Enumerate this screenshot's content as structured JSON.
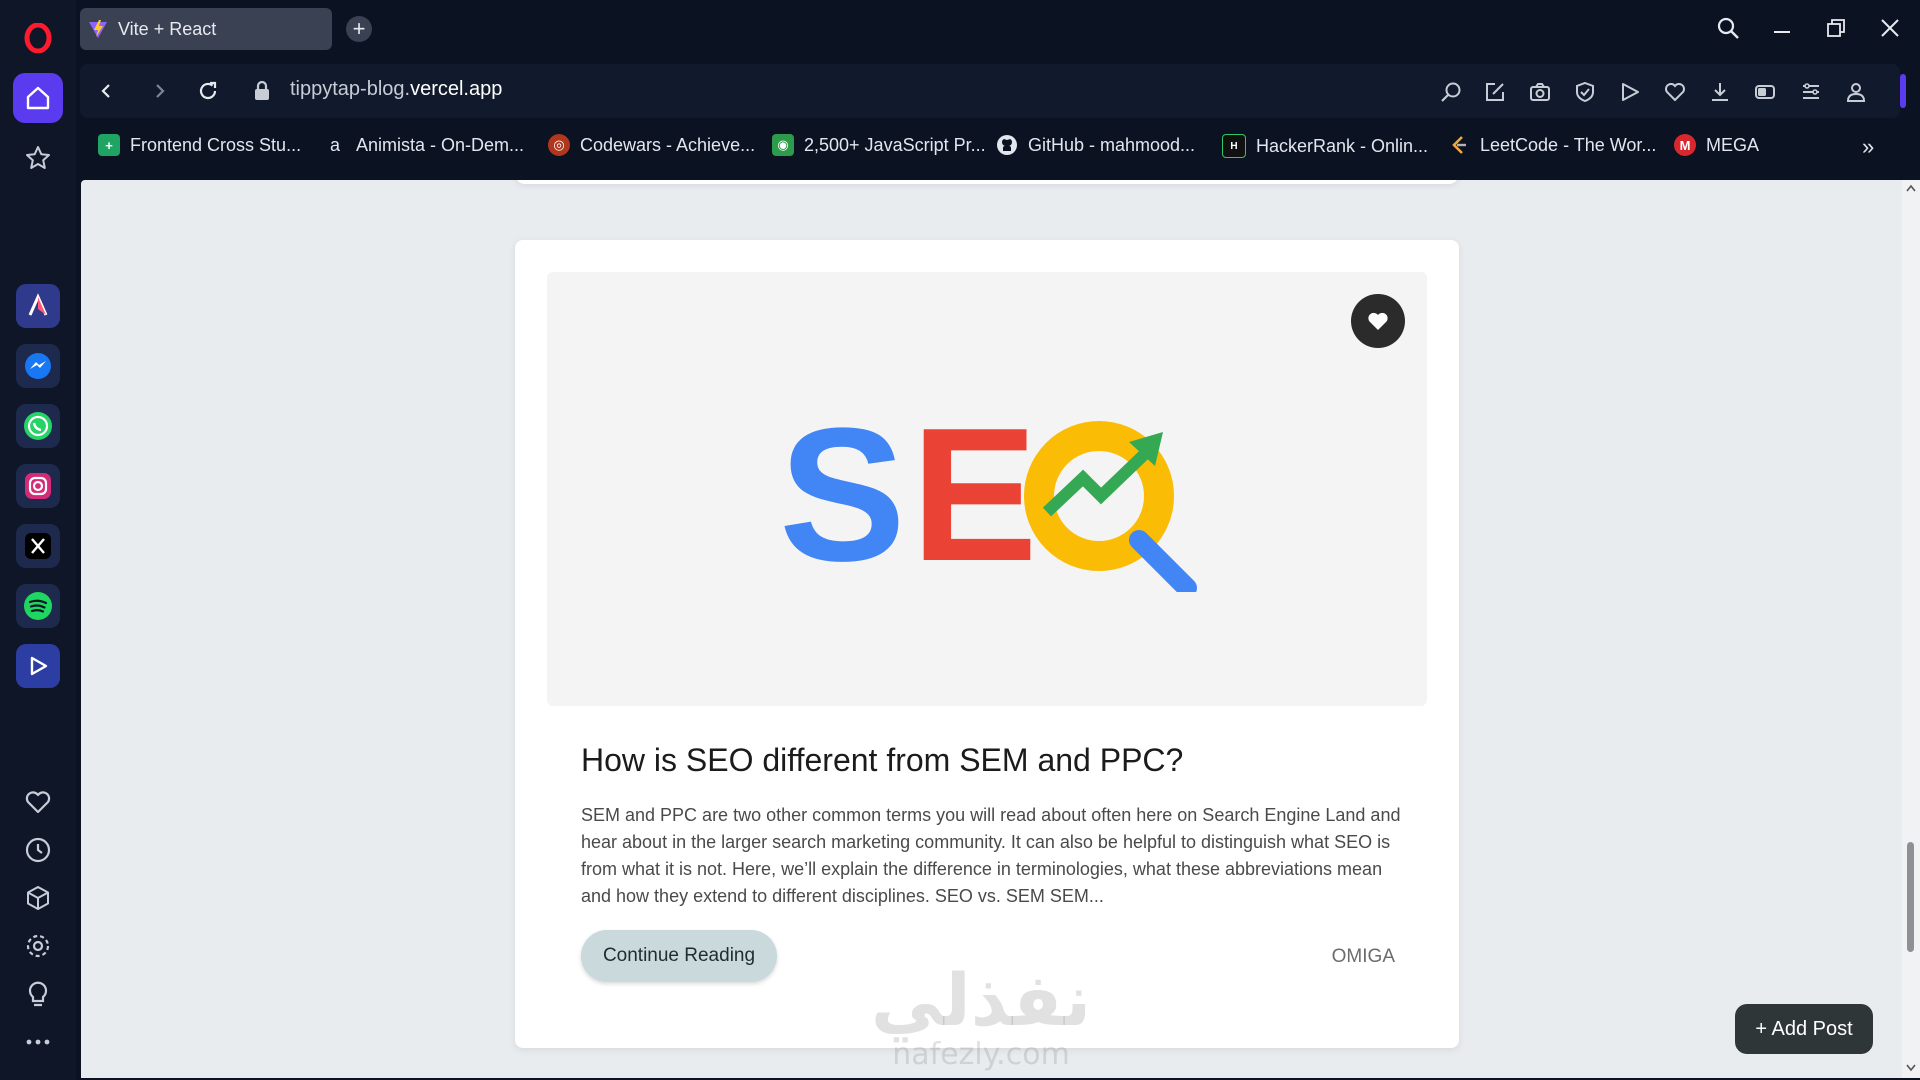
{
  "browser": {
    "tab": {
      "title": "Vite + React"
    },
    "new_tab": "+",
    "address": {
      "host_prefix": "tippytap-blog.",
      "host_main": "vercel.app"
    },
    "bookmarks": [
      {
        "label": "Frontend Cross Stu...",
        "icon": "green-plus",
        "color": "#1fa463"
      },
      {
        "label": "Animista - On-Dem...",
        "icon": "letter-a",
        "color": "#0b1222"
      },
      {
        "label": "Codewars - Achieve...",
        "icon": "codewars",
        "color": "#b1361e"
      },
      {
        "label": "2,500+ JavaScript Pr...",
        "icon": "owl",
        "color": "#2e9a4b"
      },
      {
        "label": "GitHub - mahmood...",
        "icon": "github",
        "color": "#0b1222"
      },
      {
        "label": "HackerRank - Onlin...",
        "icon": "hackerrank",
        "color": "#111111"
      },
      {
        "label": "LeetCode - The Wor...",
        "icon": "leetcode",
        "color": "#0b1222"
      },
      {
        "label": "MEGA",
        "icon": "mega",
        "color": "#d9272e"
      }
    ],
    "more_bookmarks": "»"
  },
  "post": {
    "title": "How is SEO different from SEM and PPC?",
    "excerpt": "SEM and PPC are two other common terms you will read about often here on Search Engine Land and hear about in the larger search marketing community. It can also be helpful to distinguish what SEO is from what it is not. Here, we’ll explain the difference in terminologies, what these abbreviations mean and how they extend to different disciplines. SEO vs. SEM SEM...",
    "cta": "Continue Reading",
    "author": "OMIGA",
    "image_text": "SEO"
  },
  "actions": {
    "add_post": "+ Add Post"
  },
  "watermark": {
    "arabic": "نفذلي",
    "latin": "nafezly.com"
  },
  "colors": {
    "seo_s": "#4285f4",
    "seo_e": "#ea4335",
    "seo_o": "#fbbc05",
    "seo_arrow": "#34a853",
    "accent": "#5b3bf0"
  }
}
